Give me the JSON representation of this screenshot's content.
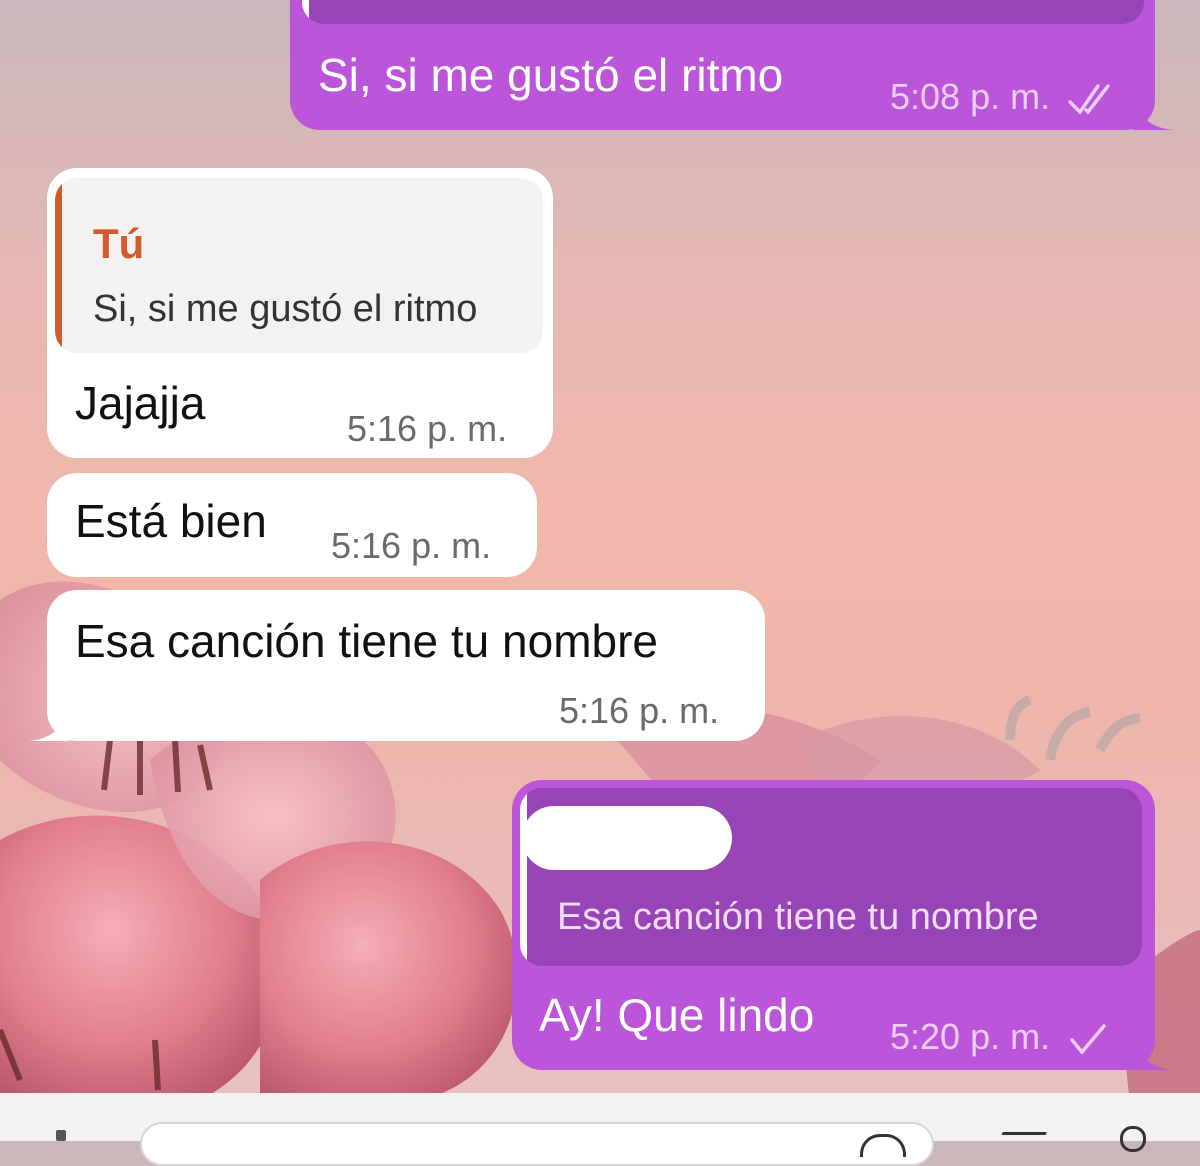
{
  "messages": [
    {
      "direction": "outgoing",
      "text": "Si, si me gustó el ritmo",
      "time": "5:08 p. m.",
      "status": "read-double-check"
    },
    {
      "direction": "incoming",
      "reply_to": {
        "author": "Tú",
        "text": "Si, si me gustó el ritmo"
      },
      "text": "Jajajja",
      "time": "5:16 p. m."
    },
    {
      "direction": "incoming",
      "text": "Está bien",
      "time": "5:16 p. m."
    },
    {
      "direction": "incoming",
      "text": "Esa canción tiene tu nombre",
      "time": "5:16 p. m."
    },
    {
      "direction": "outgoing",
      "reply_to": {
        "author": "",
        "text": "Esa canción tiene tu nombre"
      },
      "text": "Ay! Que lindo",
      "time": "5:20 p. m.",
      "status": "sent-single-check"
    }
  ],
  "colors": {
    "outgoing_bubble": "#bb55d9",
    "incoming_bubble": "#ffffff",
    "reply_accent_incoming": "#d25a2c"
  },
  "icons": [
    "double-check-icon",
    "single-check-icon"
  ]
}
